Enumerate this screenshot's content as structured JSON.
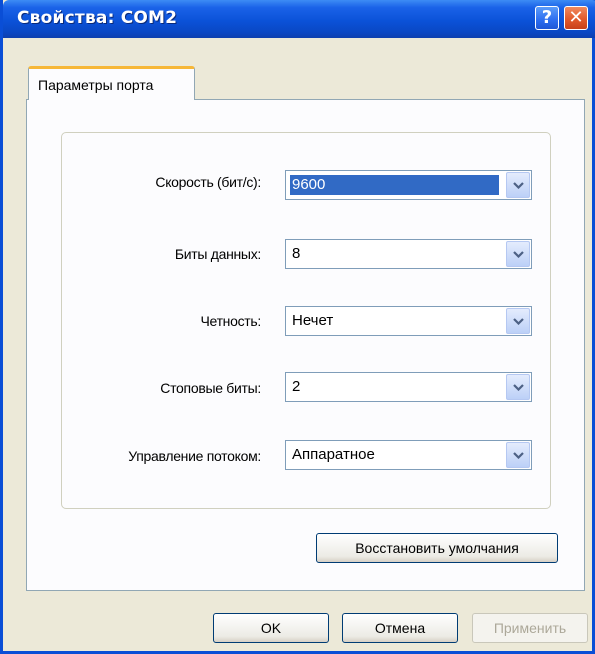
{
  "window": {
    "title": "Свойства: COM2",
    "help_label": "?",
    "close_label": "✕"
  },
  "tab": {
    "label": "Параметры порта"
  },
  "fields": [
    {
      "label": "Скорость (бит/с):",
      "value": "9600",
      "selected": true
    },
    {
      "label": "Биты данных:",
      "value": "8"
    },
    {
      "label": "Четность:",
      "value": "Нечет"
    },
    {
      "label": "Стоповые биты:",
      "value": "2"
    },
    {
      "label": "Управление потоком:",
      "value": "Аппаратное"
    }
  ],
  "restore_label": "Восстановить умолчания",
  "buttons": {
    "ok": "OK",
    "cancel": "Отмена",
    "apply": "Применить"
  }
}
